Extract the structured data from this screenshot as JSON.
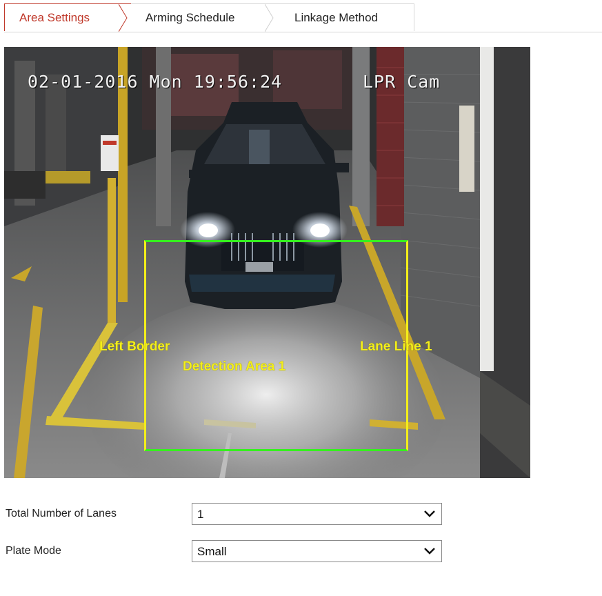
{
  "tabs": {
    "area_settings": "Area Settings",
    "arming_schedule": "Arming Schedule",
    "linkage_method": "Linkage Method",
    "active": "area_settings",
    "accent_color": "#c0392b"
  },
  "video": {
    "osd_datetime": "02-01-2016 Mon 19:56:24",
    "osd_camera_name": "LPR Cam",
    "overlay_labels": {
      "left_border": "Left Border",
      "detection_area": "Detection Area 1",
      "lane_line": "Lane Line 1"
    },
    "detection_box_color": "#35f01e",
    "lane_line_color": "#f3ee1a"
  },
  "form": {
    "total_lanes": {
      "label": "Total Number of Lanes",
      "value": "1"
    },
    "plate_mode": {
      "label": "Plate Mode",
      "value": "Small"
    }
  }
}
